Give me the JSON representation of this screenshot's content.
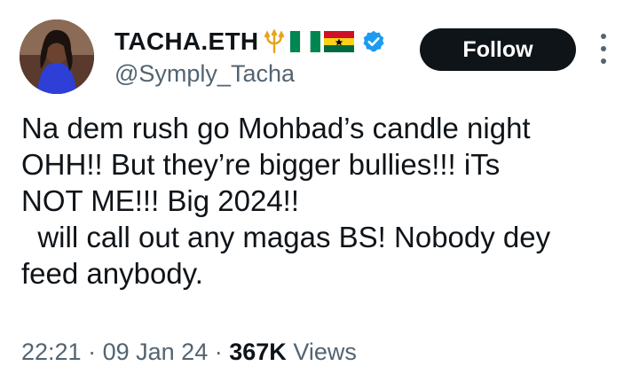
{
  "user": {
    "display_name": "TACHA.ETH",
    "handle": "@Symply_Tacha",
    "verified": true,
    "name_emojis": [
      "trident-icon",
      "nigeria-flag-icon",
      "ghana-flag-icon"
    ]
  },
  "actions": {
    "follow_label": "Follow",
    "more_icon": "more-vertical-icon"
  },
  "tweet": {
    "lines": [
      "Na dem rush go Mohbad’s candle night",
      "OHH!! But they’re bigger bullies!!! iTs",
      "NOT ME!!! Big 2024!!",
      "  will call out any magas BS! Nobody dey",
      "feed anybody."
    ]
  },
  "meta": {
    "time": "22:21",
    "separator": "·",
    "date": "09 Jan 24",
    "views_count": "367K",
    "views_label": "Views"
  },
  "colors": {
    "primary_text": "#0f1419",
    "secondary_text": "#536471",
    "verified_blue": "#1d9bf0",
    "follow_bg": "#0f1419"
  }
}
